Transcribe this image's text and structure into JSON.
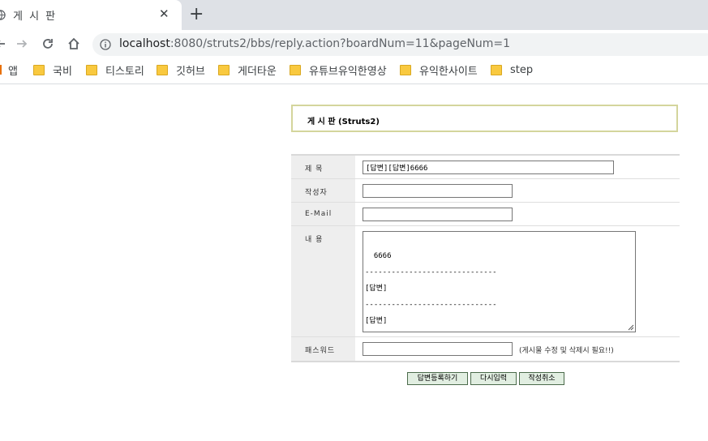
{
  "browser": {
    "tab_title": "게 시 판",
    "url_host": "localhost",
    "url_rest": ":8080/struts2/bbs/reply.action?boardNum=11&pageNum=1",
    "bookmarks": [
      "앱",
      "국비",
      "티스토리",
      "깃허브",
      "게더타운",
      "유튜브유익한영상",
      "유익한사이트",
      "step"
    ]
  },
  "board": {
    "title": "게 시 판 (Struts2)"
  },
  "form": {
    "subject_label": "제      목",
    "subject_value": "[답변][답변]6666",
    "writer_label": "작성자",
    "writer_value": "",
    "email_label": "E-Mail",
    "email_value": "",
    "content_label": "내      용",
    "content_value": "6666\n------------------------------\n[답변]\n------------------------------\n[답변]",
    "password_label": "패스워드",
    "password_value": "",
    "password_hint": "(게시물 수정 및 삭제시 필요!!)"
  },
  "buttons": {
    "submit": "답변등록하기",
    "reset": "다시입력",
    "cancel": "작성취소"
  }
}
